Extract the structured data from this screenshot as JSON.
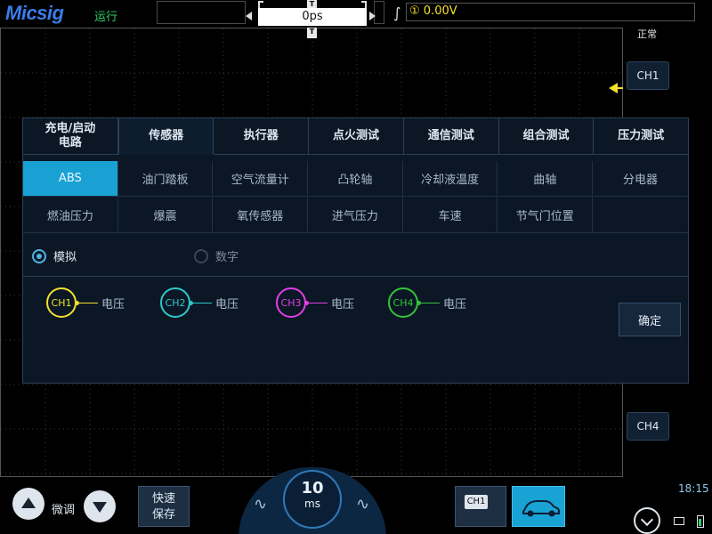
{
  "header": {
    "brand": "Micsig",
    "run_status": "运行",
    "timebase_offset": "0ps",
    "trigger_marker": "T",
    "trigger_channel_badge": "①",
    "trigger_level": "0.00V"
  },
  "side": {
    "mode": "正常",
    "ch1_label": "CH1",
    "ch4_label": "CH4"
  },
  "dialog": {
    "tabs": [
      {
        "line1": "充电/启动",
        "line2": "电路"
      },
      {
        "line1": "传感器",
        "line2": ""
      },
      {
        "line1": "执行器",
        "line2": ""
      },
      {
        "line1": "点火测试",
        "line2": ""
      },
      {
        "line1": "通信测试",
        "line2": ""
      },
      {
        "line1": "组合测试",
        "line2": ""
      },
      {
        "line1": "压力测试",
        "line2": ""
      }
    ],
    "active_tab": "传感器",
    "sensors_row1": [
      "ABS",
      "油门踏板",
      "空气流量计",
      "凸轮轴",
      "冷却液温度",
      "曲轴",
      "分电器"
    ],
    "sensors_row2": [
      "燃油压力",
      "爆震",
      "氧传感器",
      "进气压力",
      "车速",
      "节气门位置",
      ""
    ],
    "selected_sensor": "ABS",
    "signal_modes": {
      "analog": "模拟",
      "digital": "数字",
      "selected": "模拟"
    },
    "channels": [
      {
        "id": "CH1",
        "label": "电压",
        "color": "#f4e02b"
      },
      {
        "id": "CH2",
        "label": "电压",
        "color": "#2fc7c9"
      },
      {
        "id": "CH3",
        "label": "电压",
        "color": "#e23ee6"
      },
      {
        "id": "CH4",
        "label": "电压",
        "color": "#36c23a"
      }
    ],
    "confirm": "确定"
  },
  "bottom": {
    "fine_adjust": "微调",
    "quick_save_line1": "快速",
    "quick_save_line2": "保存",
    "timebase_value": "10",
    "timebase_unit": "ms",
    "ch1_stack_label": "CH1",
    "clock": "18:15"
  },
  "colors": {
    "accent": "#1aa1d3",
    "grid_line": "#3a3a3a",
    "trigger": "#f4e02b"
  }
}
